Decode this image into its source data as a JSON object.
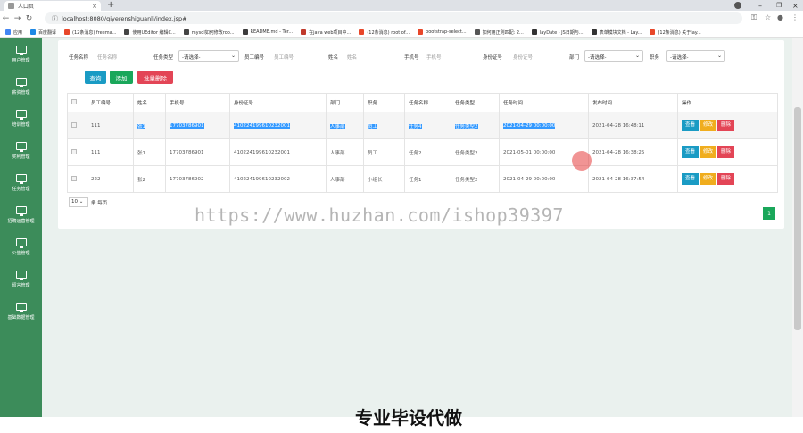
{
  "browser": {
    "tab_title": "人口页",
    "url": "localhost:8080/qiyerenshiguanli/index.jsp#"
  },
  "bookmarks": [
    {
      "label": "应用",
      "color": "#4285f4"
    },
    {
      "label": "百度翻译",
      "color": "#1e88e5"
    },
    {
      "label": "(12条消息) freema...",
      "color": "#e8472a"
    },
    {
      "label": "使用UEditor 编辑C...",
      "color": "#444"
    },
    {
      "label": "mysql如何修改roo...",
      "color": "#444"
    },
    {
      "label": "README.md - Ter...",
      "color": "#3c3c3c"
    },
    {
      "label": "在java web项目中...",
      "color": "#c0392b"
    },
    {
      "label": "(12条消息) root of...",
      "color": "#e8472a"
    },
    {
      "label": "bootstrap-select...",
      "color": "#e8472a"
    },
    {
      "label": "如何用正则匹配: 2...",
      "color": "#555"
    },
    {
      "label": "layDate - JS日期与...",
      "color": "#333"
    },
    {
      "label": "表单模块文档 - Lay...",
      "color": "#333"
    },
    {
      "label": "(12条消息) 关于lay...",
      "color": "#e8472a"
    }
  ],
  "sidebar": [
    "用户管理",
    "薪资管理",
    "培训管理",
    "奖利管理",
    "任务管理",
    "招聘运营管理",
    "公告管理",
    "留言管理",
    "基础数据管理"
  ],
  "filters": {
    "task_name_label": "任务名称",
    "task_name_ph": "任务名称",
    "task_type_label": "任务类型",
    "task_type_value": "-请选择-",
    "emp_no_label": "员工编号",
    "emp_no_ph": "员工编号",
    "name_label": "姓名",
    "name_ph": "姓名",
    "phone_label": "手机号",
    "phone_ph": "手机号",
    "idcard_label": "身份证号",
    "idcard_ph": "身份证号",
    "dept_label": "部门",
    "dept_value": "-请选择-",
    "post_label": "职务",
    "post_value": "-请选择-"
  },
  "buttons": {
    "search": "查询",
    "add": "添加",
    "batch_delete": "批量删除"
  },
  "table": {
    "headers": [
      "员工编号",
      "姓名",
      "手机号",
      "身份证号",
      "部门",
      "职务",
      "任务名称",
      "任务类型",
      "任务时间",
      "发布时间",
      "操作"
    ],
    "rows": [
      [
        "111",
        "张1",
        "17703786901",
        "410224199610232001",
        "人事部",
        "员工",
        "任务4",
        "任务类型2",
        "2021-04-29 00:00:00",
        "2021-04-28 16:48:11"
      ],
      [
        "111",
        "张1",
        "17703786901",
        "410224199610232001",
        "人事部",
        "员工",
        "任务2",
        "任务类型2",
        "2021-05-01 00:00:00",
        "2021-04-28 16:38:25"
      ],
      [
        "222",
        "张2",
        "17703786902",
        "410224199610232002",
        "人事部",
        "小组长",
        "任务1",
        "任务类型2",
        "2021-04-29 00:00:00",
        "2021-04-28 16:37:54"
      ]
    ],
    "actions": {
      "view": "查看",
      "edit": "修改",
      "delete": "删除"
    }
  },
  "pager": {
    "page_size": "10",
    "per_page": "条 每页",
    "page": "1"
  },
  "watermark": "https://www.huzhan.com/ishop39397",
  "banner": "专业毕设代做",
  "colors": {
    "sidebar": "#3c8c5a",
    "search": "#1a9bc4",
    "add": "#1aa75a",
    "danger": "#e34556",
    "warning": "#f0ad1e",
    "selection": "#3399ff"
  }
}
